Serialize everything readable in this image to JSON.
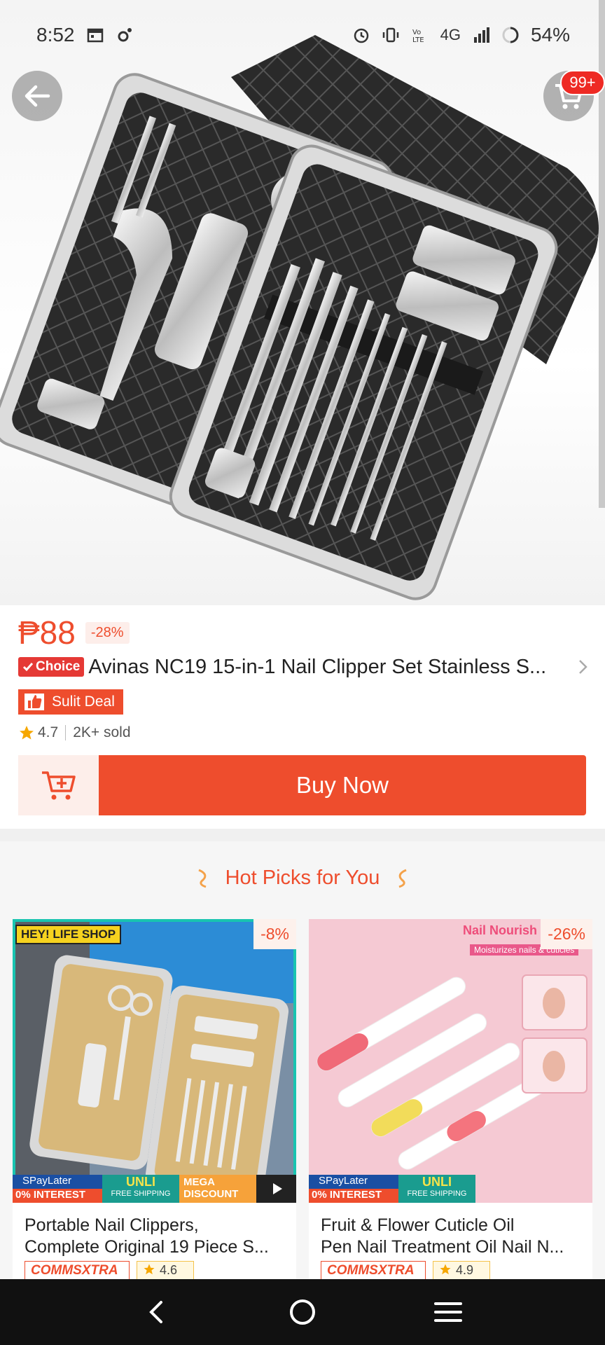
{
  "status_bar": {
    "time": "8:52",
    "network": "4G",
    "battery": "54%"
  },
  "header": {
    "cart_badge": "99+"
  },
  "product": {
    "price": "₱88",
    "discount": "-28%",
    "choice_label": "Choice",
    "title": "Avinas NC19 15-in-1 Nail Clipper Set Stainless S...",
    "deal_label": "Sulit Deal",
    "rating": "4.7",
    "sold": "2K+ sold",
    "buy_now_label": "Buy Now"
  },
  "hot_picks": {
    "title": "Hot Picks for You",
    "items": [
      {
        "discount": "-8%",
        "title_line1": "Portable Nail Clippers,",
        "title_line2": "Complete Original 19 Piece S...",
        "tag": "COMMSXTRA",
        "rating": "4.6",
        "image_badge": "HEY! LIFE SHOP",
        "banner_left": "SPayLater",
        "banner_left_sub": "0% INTEREST",
        "banner_mid": "UNLI",
        "banner_mid_sub": "FREE SHIPPING",
        "banner_right": "MEGA DISCOUNT"
      },
      {
        "discount": "-26%",
        "title_line1": "Fruit & Flower Cuticle Oil",
        "title_line2": "Pen Nail Treatment Oil Nail N...",
        "tag": "COMMSXTRA",
        "rating": "4.9",
        "image_badge": "Nail Nourish",
        "image_sub": "Moisturizes nails & cuticles",
        "banner_left": "SPayLater",
        "banner_left_sub": "0% INTEREST",
        "banner_mid": "UNLI",
        "banner_mid_sub": "FREE SHIPPING"
      }
    ]
  },
  "colors": {
    "accent": "#ee4d2d",
    "badge_red": "#ee2a24",
    "nav_bg": "#111111"
  }
}
